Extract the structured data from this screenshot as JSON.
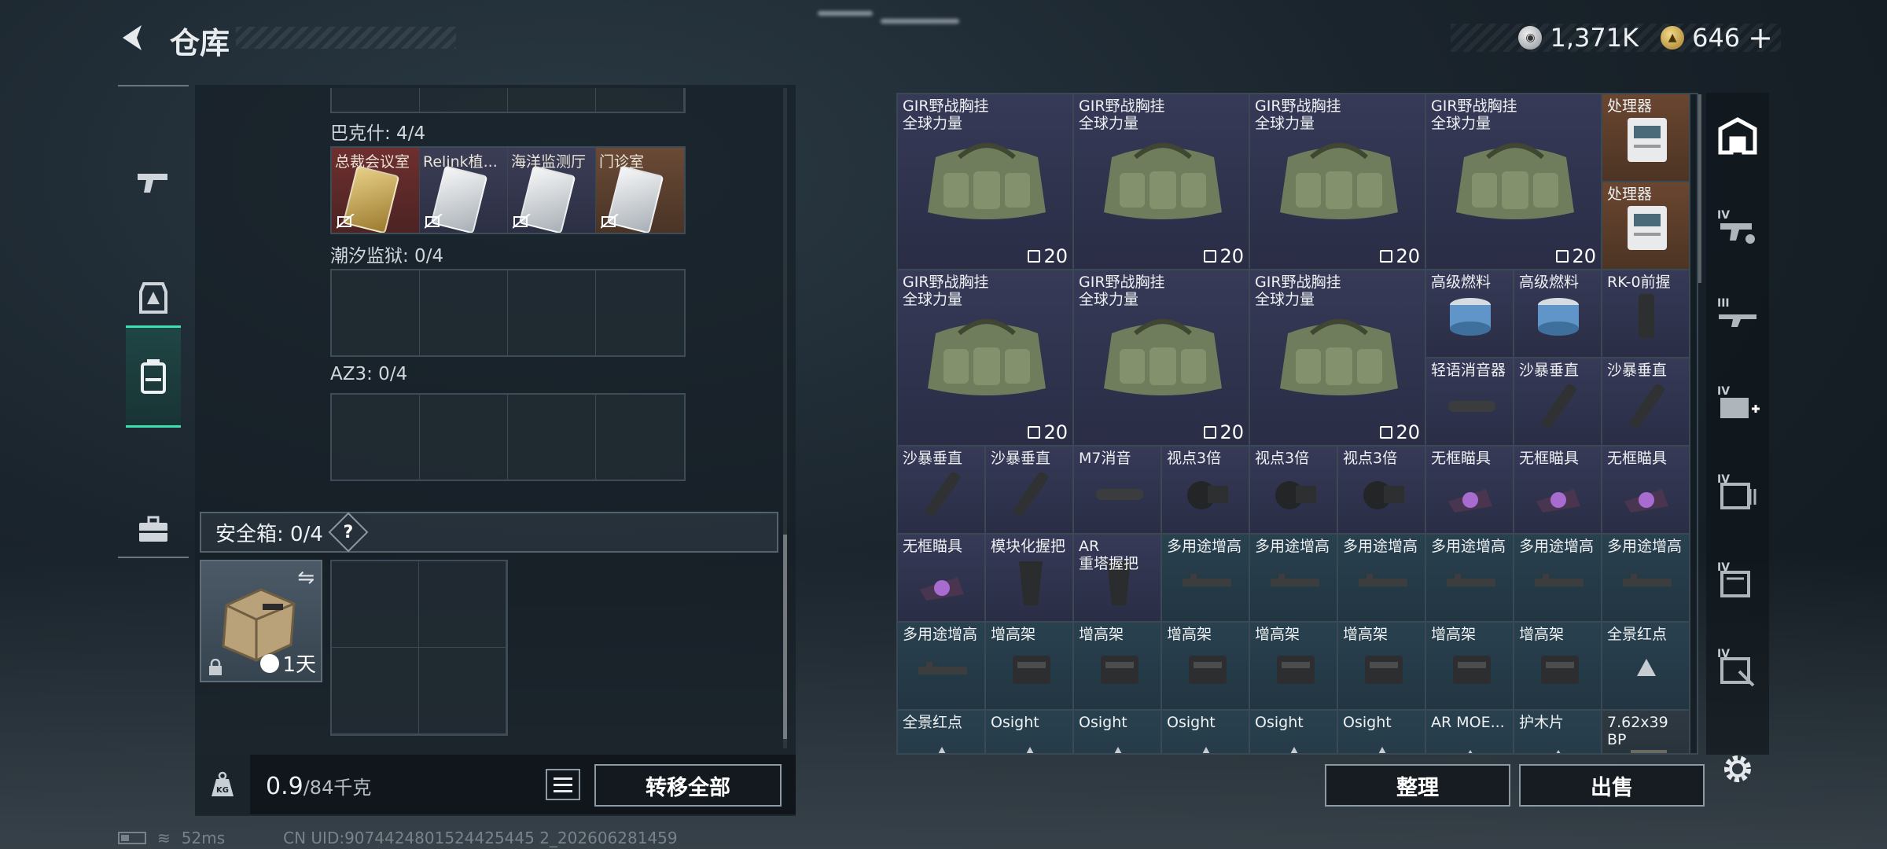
{
  "header": {
    "title": "仓库",
    "currencies": [
      {
        "icon": "silver-coin-icon",
        "value": "1,371K"
      },
      {
        "icon": "gold-coin-icon",
        "value": "646"
      }
    ],
    "add_label": "+"
  },
  "left_tabs": [
    {
      "icon": "pistol-icon",
      "active": false
    },
    {
      "icon": "armor-icon",
      "active": false
    },
    {
      "icon": "backpack-icon",
      "active": true
    },
    {
      "icon": "briefcase-icon",
      "active": false
    }
  ],
  "containers": [
    {
      "title": "巴克什: 4/4",
      "cards": [
        {
          "label": "总裁会议室",
          "color": "red",
          "card": "gold"
        },
        {
          "label": "Relink植...",
          "color": "blue",
          "card": "white"
        },
        {
          "label": "海洋监测厅",
          "color": "blue",
          "card": "white"
        },
        {
          "label": "门诊室",
          "color": "brown",
          "card": "white"
        }
      ]
    },
    {
      "title": "潮汐监狱: 0/4"
    },
    {
      "title": "AZ3: 0/4"
    }
  ],
  "safebox": {
    "title": "安全箱: 0/4",
    "help": "?",
    "timer": "1天"
  },
  "weight": {
    "current": "0.9",
    "capacity": "/84千克"
  },
  "buttons": {
    "transfer_all": "转移全部",
    "sort": "整理",
    "sell": "出售"
  },
  "status": {
    "ping": "52ms",
    "uid": "CN UID:9074424801524425445 2_202606281459"
  },
  "inventory": {
    "vest_name": "GIR野战胸挂\n全球力量",
    "vest_count": "20",
    "cells": [
      {
        "name": "处理器",
        "color": "orange",
        "icon": "processor-icon"
      },
      {
        "name": "处理器",
        "color": "orange",
        "icon": "processor-icon"
      },
      {
        "name": "高级燃料",
        "color": "violet",
        "icon": "fuel-can-icon"
      },
      {
        "name": "高级燃料",
        "color": "violet",
        "icon": "fuel-can-icon"
      },
      {
        "name": "RK-0前握",
        "color": "violet",
        "icon": "foregrip-icon"
      },
      {
        "name": "轻语消音器",
        "color": "violet",
        "icon": "suppressor-icon"
      },
      {
        "name": "沙暴垂直",
        "color": "violet",
        "icon": "vertical-grip-icon"
      },
      {
        "name": "沙暴垂直",
        "color": "violet",
        "icon": "vertical-grip-icon"
      },
      {
        "name": "沙暴垂直",
        "color": "violet",
        "icon": "vertical-grip-icon"
      },
      {
        "name": "沙暴垂直",
        "color": "violet",
        "icon": "vertical-grip-icon"
      },
      {
        "name": "M7消音",
        "color": "violet",
        "icon": "suppressor-icon"
      },
      {
        "name": "视点3倍",
        "color": "violet",
        "icon": "scope-icon"
      },
      {
        "name": "视点3倍",
        "color": "violet",
        "icon": "scope-icon"
      },
      {
        "name": "视点3倍",
        "color": "violet",
        "icon": "scope-icon"
      },
      {
        "name": "无框瞄具",
        "color": "violet",
        "icon": "red-dot-icon"
      },
      {
        "name": "无框瞄具",
        "color": "violet",
        "icon": "red-dot-icon"
      },
      {
        "name": "无框瞄具",
        "color": "violet",
        "icon": "red-dot-icon"
      },
      {
        "name": "无框瞄具",
        "color": "violet",
        "icon": "red-dot-icon"
      },
      {
        "name": "模块化握把",
        "color": "violet",
        "icon": "pistol-grip-icon"
      },
      {
        "name": "AR\n重塔握把",
        "color": "violet",
        "icon": "pistol-grip-icon"
      },
      {
        "name": "多用途增高",
        "color": "blue",
        "icon": "riser-icon"
      },
      {
        "name": "多用途增高",
        "color": "blue",
        "icon": "riser-icon"
      },
      {
        "name": "多用途增高",
        "color": "blue",
        "icon": "riser-icon"
      },
      {
        "name": "多用途增高",
        "color": "blue",
        "icon": "riser-icon"
      },
      {
        "name": "多用途增高",
        "color": "blue",
        "icon": "riser-icon"
      },
      {
        "name": "多用途增高",
        "color": "blue",
        "icon": "riser-icon"
      },
      {
        "name": "多用途增高",
        "color": "blue",
        "icon": "riser-icon"
      },
      {
        "name": "增高架",
        "color": "blue",
        "icon": "mount-icon"
      },
      {
        "name": "增高架",
        "color": "blue",
        "icon": "mount-icon"
      },
      {
        "name": "增高架",
        "color": "blue",
        "icon": "mount-icon"
      },
      {
        "name": "增高架",
        "color": "blue",
        "icon": "mount-icon"
      },
      {
        "name": "增高架",
        "color": "blue",
        "icon": "mount-icon"
      },
      {
        "name": "增高架",
        "color": "blue",
        "icon": "mount-icon"
      },
      {
        "name": "增高架",
        "color": "blue",
        "icon": "mount-icon"
      },
      {
        "name": "全景红点",
        "color": "blue",
        "icon": "holo-sight-icon"
      },
      {
        "name": "全景红点",
        "color": "blue",
        "icon": "holo-sight-icon"
      },
      {
        "name": "Osight",
        "color": "blue",
        "icon": "holo-sight-icon"
      },
      {
        "name": "Osight",
        "color": "blue",
        "icon": "holo-sight-icon"
      },
      {
        "name": "Osight",
        "color": "blue",
        "icon": "holo-sight-icon"
      },
      {
        "name": "Osight",
        "color": "blue",
        "icon": "holo-sight-icon"
      },
      {
        "name": "Osight",
        "color": "blue",
        "icon": "holo-sight-icon"
      },
      {
        "name": "AR MOE...",
        "color": "blue",
        "icon": "stock-icon"
      },
      {
        "name": "护木片",
        "color": "blue",
        "icon": "handguard-icon"
      },
      {
        "name": "7.62x39\nBP",
        "color": "gray",
        "icon": "ammo-icon"
      }
    ]
  },
  "filter_rail": [
    {
      "icon": "all-items-icon",
      "tier": ""
    },
    {
      "icon": "gun-filter-icon",
      "tier": "IV"
    },
    {
      "icon": "rifle-filter-icon",
      "tier": "III"
    },
    {
      "icon": "medkit-filter-icon",
      "tier": "IV"
    },
    {
      "icon": "ammo-filter-icon",
      "tier": "IV"
    },
    {
      "icon": "container-filter-icon",
      "tier": "IV"
    },
    {
      "icon": "misc-filter-icon",
      "tier": "IV"
    }
  ]
}
